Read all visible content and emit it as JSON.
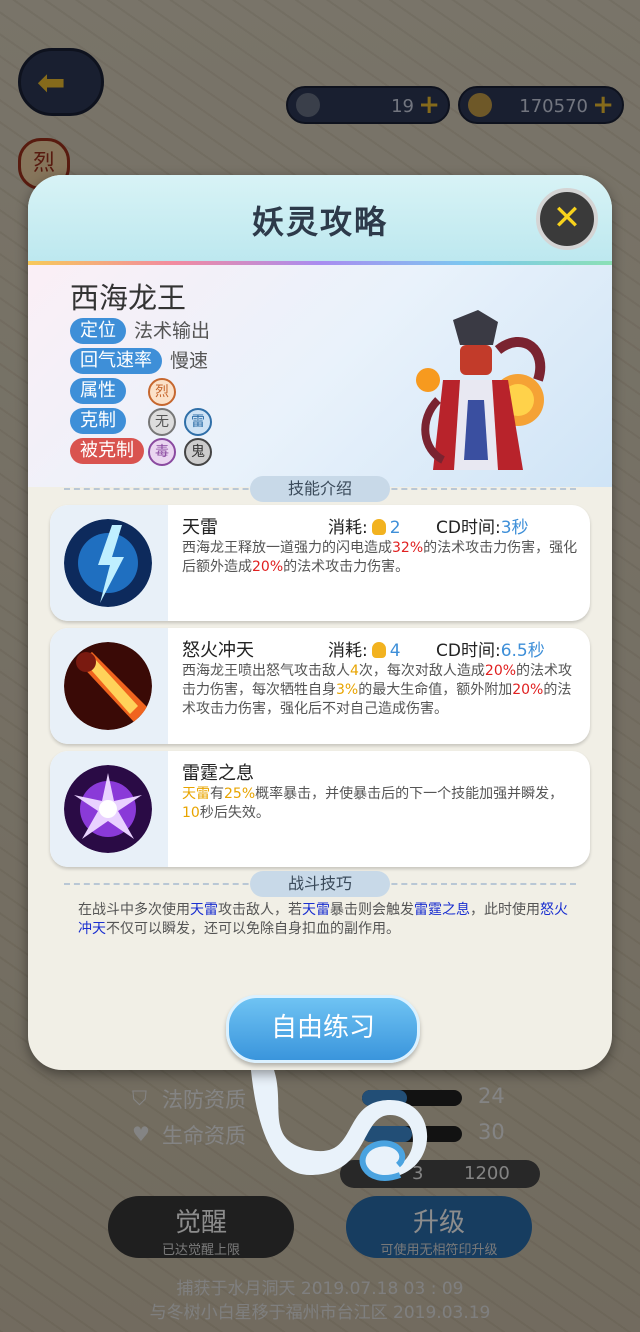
{
  "topbar": {
    "resource1_value": "19",
    "resource2_value": "170570",
    "plus": "+",
    "badge_left": "烈"
  },
  "dialog": {
    "title": "妖灵攻略",
    "close": "✕",
    "hero": {
      "name": "西海龙王",
      "position_label": "定位",
      "position_value": "法术输出",
      "regen_label": "回气速率",
      "regen_value": "慢速",
      "attr_label": "属性",
      "attr_elements": [
        "烈"
      ],
      "counter_label": "克制",
      "counter_elements": [
        "无",
        "雷"
      ],
      "countered_label": "被克制",
      "countered_elements": [
        "毒",
        "鬼"
      ]
    },
    "skills_section": "技能介绍",
    "skills": [
      {
        "name": "天雷",
        "cost_label": "消耗:",
        "cost": "2",
        "cd_label": "CD时间:",
        "cd": "3秒",
        "desc_parts": [
          "西海龙王释放一道强力的闪电造成",
          "32%",
          "的法术攻击力伤害，强化后额外造成",
          "20%",
          "的法术攻击力伤害。"
        ]
      },
      {
        "name": "怒火冲天",
        "cost_label": "消耗:",
        "cost": "4",
        "cd_label": "CD时间:",
        "cd": "6.5秒",
        "desc_parts": [
          "西海龙王喷出怒气攻击敌人",
          "4",
          "次，每次对敌人造成",
          "20%",
          "的法术攻击力伤害，每次牺牲自身",
          "3%",
          "的最大生命值，额外附加",
          "20%",
          "的法术攻击力伤害，强化后不对自己造成伤害。"
        ]
      },
      {
        "name": "雷霆之息",
        "desc_parts": [
          "天雷",
          "有",
          "25%",
          "概率暴击，并使暴击后的下一个技能加强并瞬发，",
          "10",
          "秒后失效。"
        ]
      }
    ],
    "tips_section": "战斗技巧",
    "tips_parts": [
      "在战斗中多次使用",
      "天雷",
      "攻击敌人，若",
      "天雷",
      "暴击则会触发",
      "雷霆之息",
      "，此时使用",
      "怒火冲天",
      "不仅可以瞬发，还可以免除自身扣血的副作用。"
    ],
    "practice_button": "自由练习"
  },
  "background": {
    "row1_label": "法防资质",
    "row1_value": "24",
    "row1_fill": 0.45,
    "row2_label": "生命资质",
    "row2_value": "30",
    "row2_fill": 0.5,
    "currency_value": "3",
    "currency_value2": "1200",
    "awaken_button": "觉醒",
    "awaken_sub": "已达觉醒上限",
    "upgrade_button": "升级",
    "upgrade_sub": "可使用无相符印升级",
    "footer_line1": "捕获于水月洞天  2019.07.18   03 : 09",
    "footer_line2": "与冬树小白星移于福州市台江区 2019.03.19"
  },
  "colors": {
    "accent_blue": "#3e8fd8",
    "red_value": "#e02020",
    "orange_value": "#e8a400",
    "link_blue": "#1a2fd0"
  }
}
